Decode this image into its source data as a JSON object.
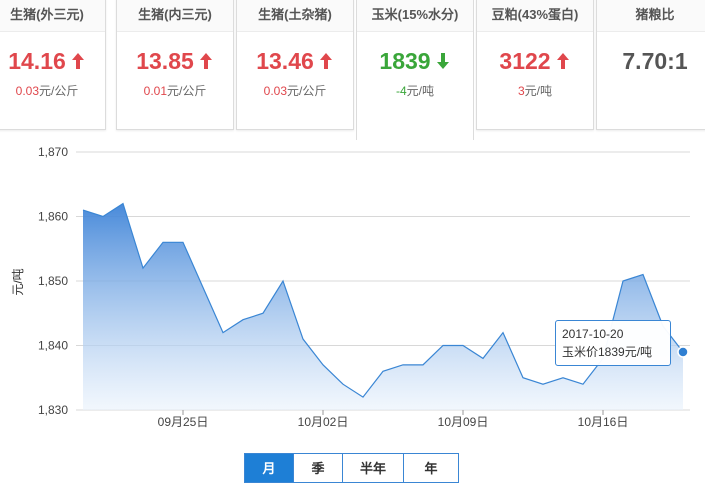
{
  "cards": [
    {
      "title": "生猪(外三元)",
      "price": "14.16",
      "change_value": "0.03",
      "change_unit": "元/公斤",
      "direction": "up"
    },
    {
      "title": "生猪(内三元)",
      "price": "13.85",
      "change_value": "0.01",
      "change_unit": "元/公斤",
      "direction": "up"
    },
    {
      "title": "生猪(土杂猪)",
      "price": "13.46",
      "change_value": "0.03",
      "change_unit": "元/公斤",
      "direction": "up"
    },
    {
      "title": "玉米(15%水分)",
      "price": "1839",
      "change_value": "-4",
      "change_unit": "元/吨",
      "direction": "down"
    },
    {
      "title": "豆粕(43%蛋白)",
      "price": "3122",
      "change_value": "3",
      "change_unit": "元/吨",
      "direction": "up"
    },
    {
      "title": "猪粮比",
      "price": "7.70:1",
      "change_value": "",
      "change_unit": "",
      "direction": "none"
    }
  ],
  "colors": {
    "up": "#e0474c",
    "down": "#3aa63a",
    "line": "#3a86d4",
    "fill_top": "#3f84d8",
    "fill_bottom": "#e9f2fc",
    "grid": "#d8d8d8"
  },
  "tooltip": {
    "date": "2017-10-20",
    "text": "玉米价1839元/吨"
  },
  "range_buttons": [
    {
      "label": "月",
      "selected": true
    },
    {
      "label": "季",
      "selected": false
    },
    {
      "label": "半年",
      "selected": false
    },
    {
      "label": "年",
      "selected": false
    }
  ],
  "chart_data": {
    "type": "area",
    "title": "",
    "xlabel": "",
    "ylabel": "元/吨",
    "ylim": [
      1830,
      1870
    ],
    "yticks": [
      "1,830",
      "1,840",
      "1,850",
      "1,860",
      "1,870"
    ],
    "x": [
      "09-20",
      "09-21",
      "09-22",
      "09-23",
      "09-24",
      "09-25",
      "09-26",
      "09-27",
      "09-28",
      "09-29",
      "09-30",
      "10-01",
      "10-02",
      "10-03",
      "10-04",
      "10-05",
      "10-06",
      "10-07",
      "10-08",
      "10-09",
      "10-10",
      "10-11",
      "10-12",
      "10-13",
      "10-14",
      "10-15",
      "10-16",
      "10-17",
      "10-18",
      "10-19",
      "10-20"
    ],
    "xticks": [
      {
        "date": "09-25",
        "label": "09月25日"
      },
      {
        "date": "10-02",
        "label": "10月02日"
      },
      {
        "date": "10-09",
        "label": "10月09日"
      },
      {
        "date": "10-16",
        "label": "10月16日"
      }
    ],
    "series": [
      {
        "values": [
          1861,
          1860,
          1862,
          1852,
          1856,
          1856,
          1849,
          1842,
          1844,
          1845,
          1850,
          1841,
          1837,
          1834,
          1832,
          1836,
          1837,
          1837,
          1840,
          1840,
          1838,
          1842,
          1835,
          1834,
          1835,
          1834,
          1838,
          1850,
          1851,
          1843,
          1839
        ]
      }
    ],
    "grid": true
  }
}
